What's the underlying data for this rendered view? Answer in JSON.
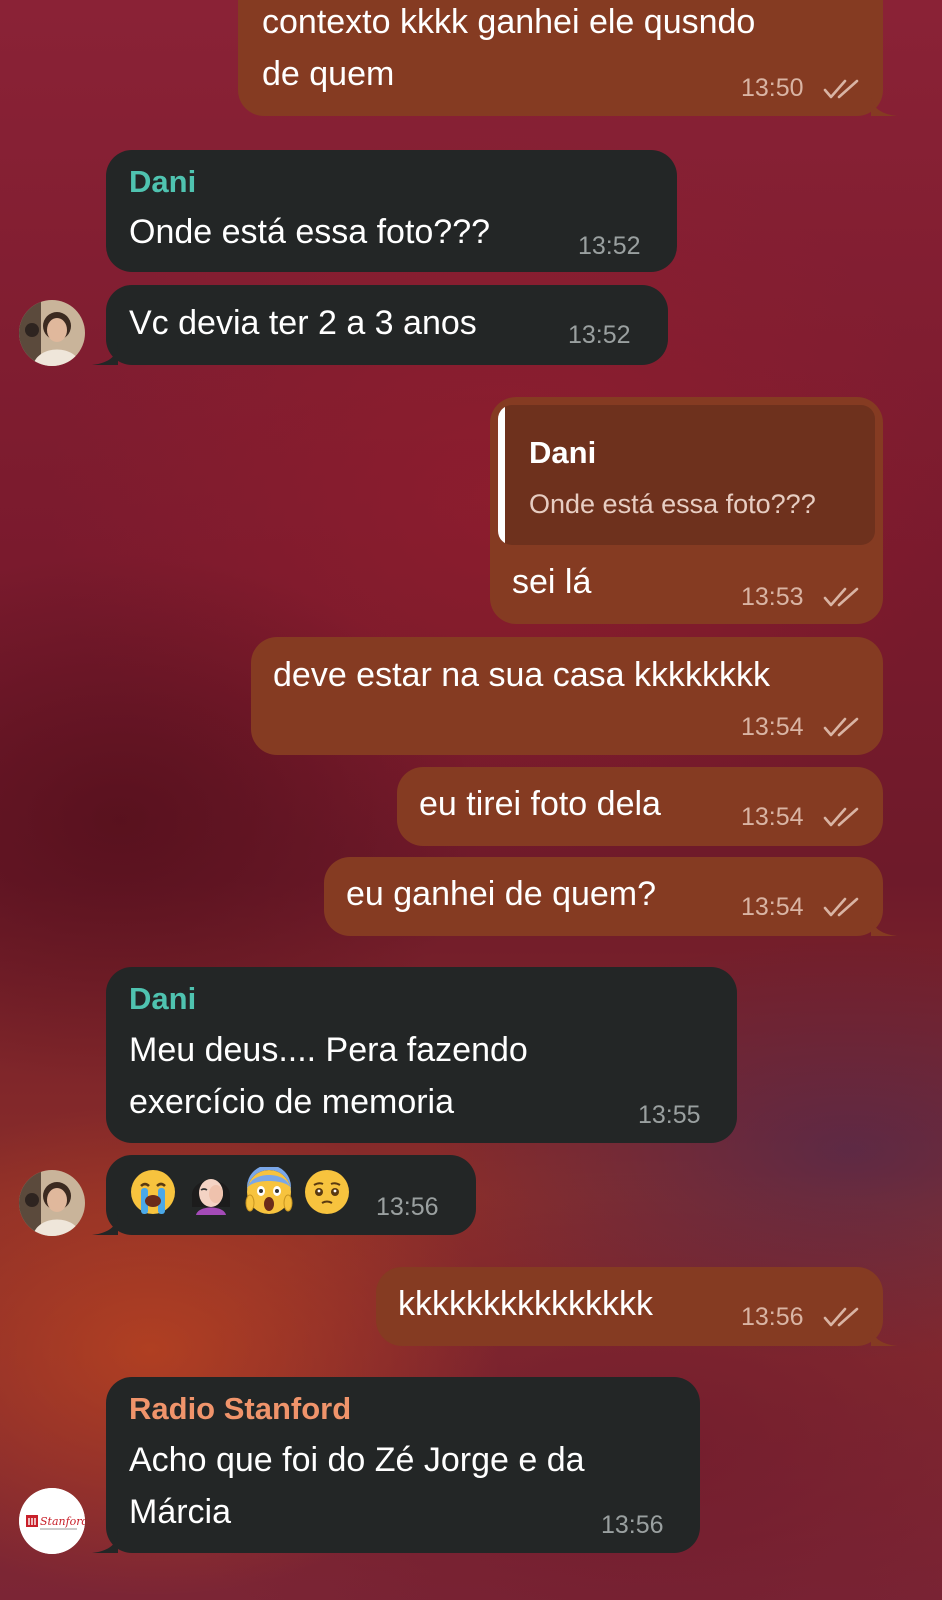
{
  "colors": {
    "incoming_bubble": "#232626",
    "outgoing_bubble": "#853b22",
    "sender_dani": "#4fc3b0",
    "sender_radio": "#f0946b",
    "quote_bar": "#ffffff"
  },
  "messages": [
    {
      "text": "contexto kkkk ganhei ele qusndo\nde quem",
      "time": "13:50",
      "status": "read"
    },
    {
      "sender": "Dani",
      "text": "Onde está essa foto???",
      "time": "13:52"
    },
    {
      "text": "Vc devia ter 2 a 3 anos",
      "time": "13:52"
    },
    {
      "quote_sender": "Dani",
      "quote_text": "Onde está essa foto???",
      "text": "sei lá",
      "time": "13:53",
      "status": "read"
    },
    {
      "text": "deve estar na sua casa kkkkkkkk",
      "time": "13:54",
      "status": "read"
    },
    {
      "text": "eu tirei foto dela",
      "time": "13:54",
      "status": "read"
    },
    {
      "text": "eu ganhei de quem?",
      "time": "13:54",
      "status": "read"
    },
    {
      "sender": "Dani",
      "text": "Meu deus.... Pera fazendo\nexercício de memoria",
      "time": "13:55"
    },
    {
      "emojis": [
        "loudly-crying-face",
        "woman-facepalming",
        "face-screaming-in-fear",
        "pleading-face"
      ],
      "time": "13:56"
    },
    {
      "text": "kkkkkkkkkkkkkkk",
      "time": "13:56",
      "status": "read"
    },
    {
      "sender": "Radio Stanford",
      "text": "Acho que foi do Zé Jorge e da\nMárcia",
      "time": "13:56"
    }
  ],
  "avatars": {
    "dani": "dani-avatar-photo",
    "radio_stanford": {
      "logo_text": "Stanford",
      "icon": "radio-stanford-logo"
    }
  }
}
